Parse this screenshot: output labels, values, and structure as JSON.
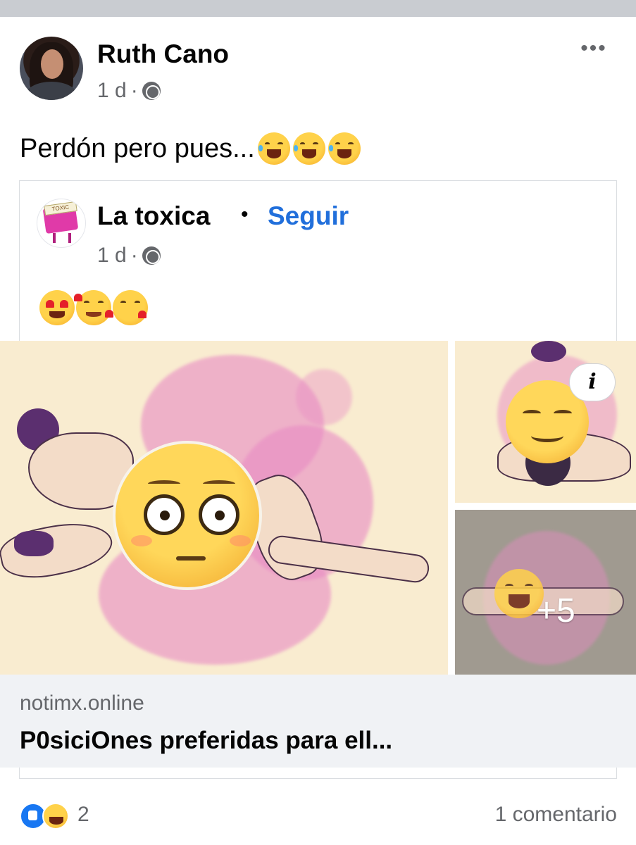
{
  "post": {
    "author": "Ruth Cano",
    "time": "1 d",
    "time_sep": "·",
    "privacy_icon": "globe-icon",
    "more_label": "•••",
    "text": "Perdón pero pues...",
    "text_emojis": [
      "rolling-on-floor-laughing",
      "rolling-on-floor-laughing",
      "rolling-on-floor-laughing"
    ]
  },
  "shared": {
    "page_name": "La toxica",
    "separator": "•",
    "follow_label": "Seguir",
    "time": "1 d",
    "time_sep": "·",
    "avatar_text": "TOXIC",
    "emojis": [
      "heart-eyes",
      "smiling-face-with-hearts",
      "kissing-face-with-heart"
    ],
    "media": {
      "info_label": "i",
      "more_count": "+5"
    },
    "link": {
      "domain": "notimx.online",
      "title": "P0siciOnes preferidas para ell..."
    }
  },
  "footer": {
    "reactions": [
      "like",
      "haha"
    ],
    "reaction_count": "2",
    "comments": "1 comentario"
  },
  "colors": {
    "link_blue": "#216fdb",
    "secondary_text": "#65676b",
    "preview_bg": "#f0f2f5",
    "like_blue": "#1877f2"
  }
}
